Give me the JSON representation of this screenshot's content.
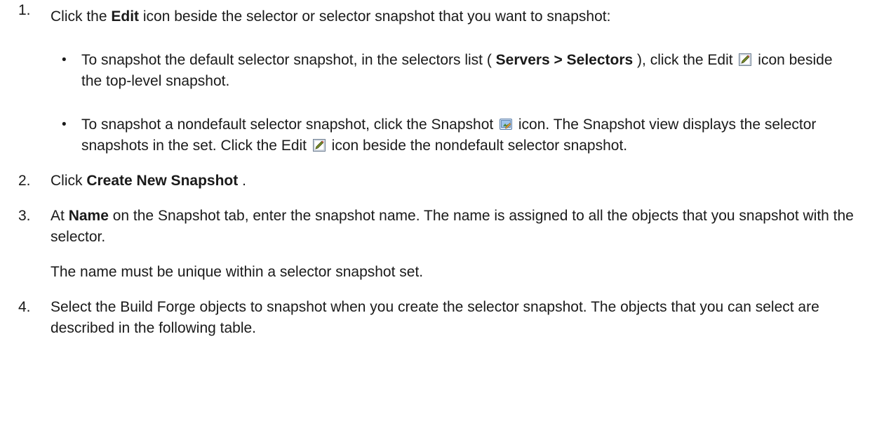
{
  "steps": [
    {
      "num": "1.",
      "pre": "Click the ",
      "bold": "Edit",
      "post": " icon beside the selector or selector snapshot that you want to snapshot:",
      "bullets": [
        {
          "dot": "•",
          "a": "To snapshot the default selector snapshot, in the selectors list ( ",
          "bold": "Servers > Selectors",
          "b": " ), click the Edit ",
          "c": " icon beside the top-level snapshot."
        },
        {
          "dot": "•",
          "a": "To snapshot a nondefault selector snapshot, click the Snapshot ",
          "b": " icon. The Snapshot view displays the selector snapshots in the set. Click the Edit ",
          "c": " icon beside the nondefault selector snapshot."
        }
      ]
    },
    {
      "num": "2.",
      "pre": "Click ",
      "bold": "Create New Snapshot",
      "post": " ."
    },
    {
      "num": "3.",
      "pre": "At ",
      "bold": "Name",
      "post": " on the Snapshot tab, enter the snapshot name. The name is assigned to all the objects that you snapshot with the selector.",
      "note": "The name must be unique within a selector snapshot set."
    },
    {
      "num": "4.",
      "text": "Select the Build Forge objects to snapshot when you create the selector snapshot. The objects that you can select are described in the following table."
    }
  ],
  "icons": {
    "edit": "edit-icon",
    "snapshot": "snapshot-icon"
  }
}
